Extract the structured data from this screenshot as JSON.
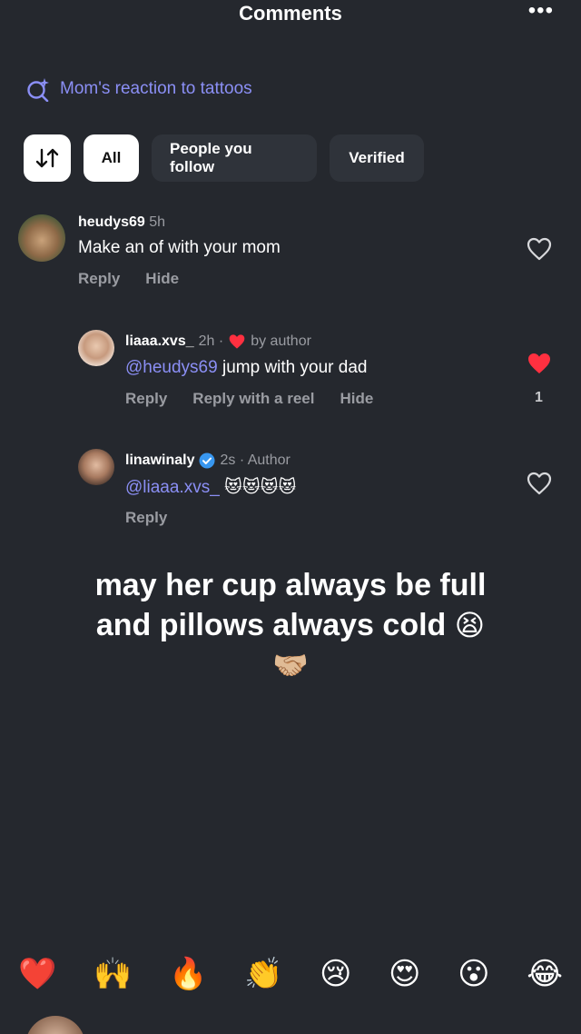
{
  "header": {
    "title": "Comments",
    "more": "•••"
  },
  "search_suggestion": "Mom's reaction to tattoos",
  "filters": {
    "sort_icon": "sort-arrows-icon",
    "all": "All",
    "following": "People you follow",
    "verified": "Verified"
  },
  "comments": [
    {
      "user": "heudys69",
      "meta": "5h",
      "text": "Make an of with your mom",
      "actions": [
        "Reply",
        "Hide"
      ]
    },
    {
      "user": "liaaa.xvs_",
      "meta": "2h ·",
      "meta2": "by author",
      "mention": "@heudys69",
      "text": " jump with your dad",
      "actions": [
        "Reply",
        "Reply with a reel",
        "Hide"
      ],
      "likes": "1"
    },
    {
      "user": "linawinaly",
      "meta": "2s · Author",
      "mention": "@liaaa.xvs_",
      "text": " 😻😻😻😻",
      "actions": [
        "Reply"
      ]
    }
  ],
  "caption": {
    "line1": "may her cup always be full",
    "line2": "and pillows always cold",
    "emoji1": "😫",
    "emoji2": "🤝🏼"
  },
  "emoji_bar": [
    "❤️",
    "🙌",
    "🔥",
    "👏",
    "😢",
    "😍",
    "😮",
    "😂"
  ],
  "colors": {
    "background": "#25282e",
    "accent": "#8b8ff5",
    "like": "#ff3040",
    "verified": "#3897f0"
  }
}
